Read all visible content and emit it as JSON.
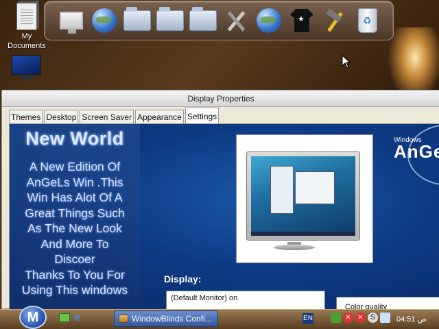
{
  "desktop": {
    "icons": [
      {
        "label": "My\nDocuments",
        "icon": "my-documents-icon"
      },
      {
        "label": "",
        "icon": "monitor-icon"
      }
    ]
  },
  "dock": {
    "items": [
      {
        "name": "my-computer",
        "icon": "computer-icon"
      },
      {
        "name": "internet",
        "icon": "globe-icon"
      },
      {
        "name": "documents-folder",
        "icon": "folder-icon"
      },
      {
        "name": "music-folder",
        "icon": "folder-icon"
      },
      {
        "name": "pictures-folder",
        "icon": "folder-icon"
      },
      {
        "name": "tools",
        "icon": "tools-icon"
      },
      {
        "name": "network",
        "icon": "globe-icon"
      },
      {
        "name": "themes",
        "icon": "tshirt-icon"
      },
      {
        "name": "settings",
        "icon": "hammer-icon"
      },
      {
        "name": "recycle-bin",
        "icon": "recycle-bin-icon"
      }
    ]
  },
  "window": {
    "title": "Display Properties",
    "tabs": [
      {
        "label": "Themes"
      },
      {
        "label": "Desktop"
      },
      {
        "label": "Screen Saver"
      },
      {
        "label": "Appearance"
      },
      {
        "label": "Settings",
        "active": true
      }
    ],
    "panel": {
      "heading": "New World",
      "lines": [
        "A New Edition Of",
        "AnGeLs Win .This",
        "Win Has Alot Of A",
        "Great Things Such",
        "As The New Look",
        "And More To",
        "Discoer",
        "Thanks To You  For",
        "Using This windows"
      ]
    },
    "brand": {
      "small": "Windows",
      "big": "AnGe"
    },
    "display_label": "Display:",
    "display_value": "(Default Monitor) on",
    "color_quality_label": "Color quality"
  },
  "taskbar": {
    "start_label": "M",
    "task_button": "WindowBlinds Confi...",
    "language": "EN",
    "clock": "04:51 ص"
  },
  "colors": {
    "accent_blue": "#0e3a84",
    "taskbar_brown": "#5a3e22"
  }
}
